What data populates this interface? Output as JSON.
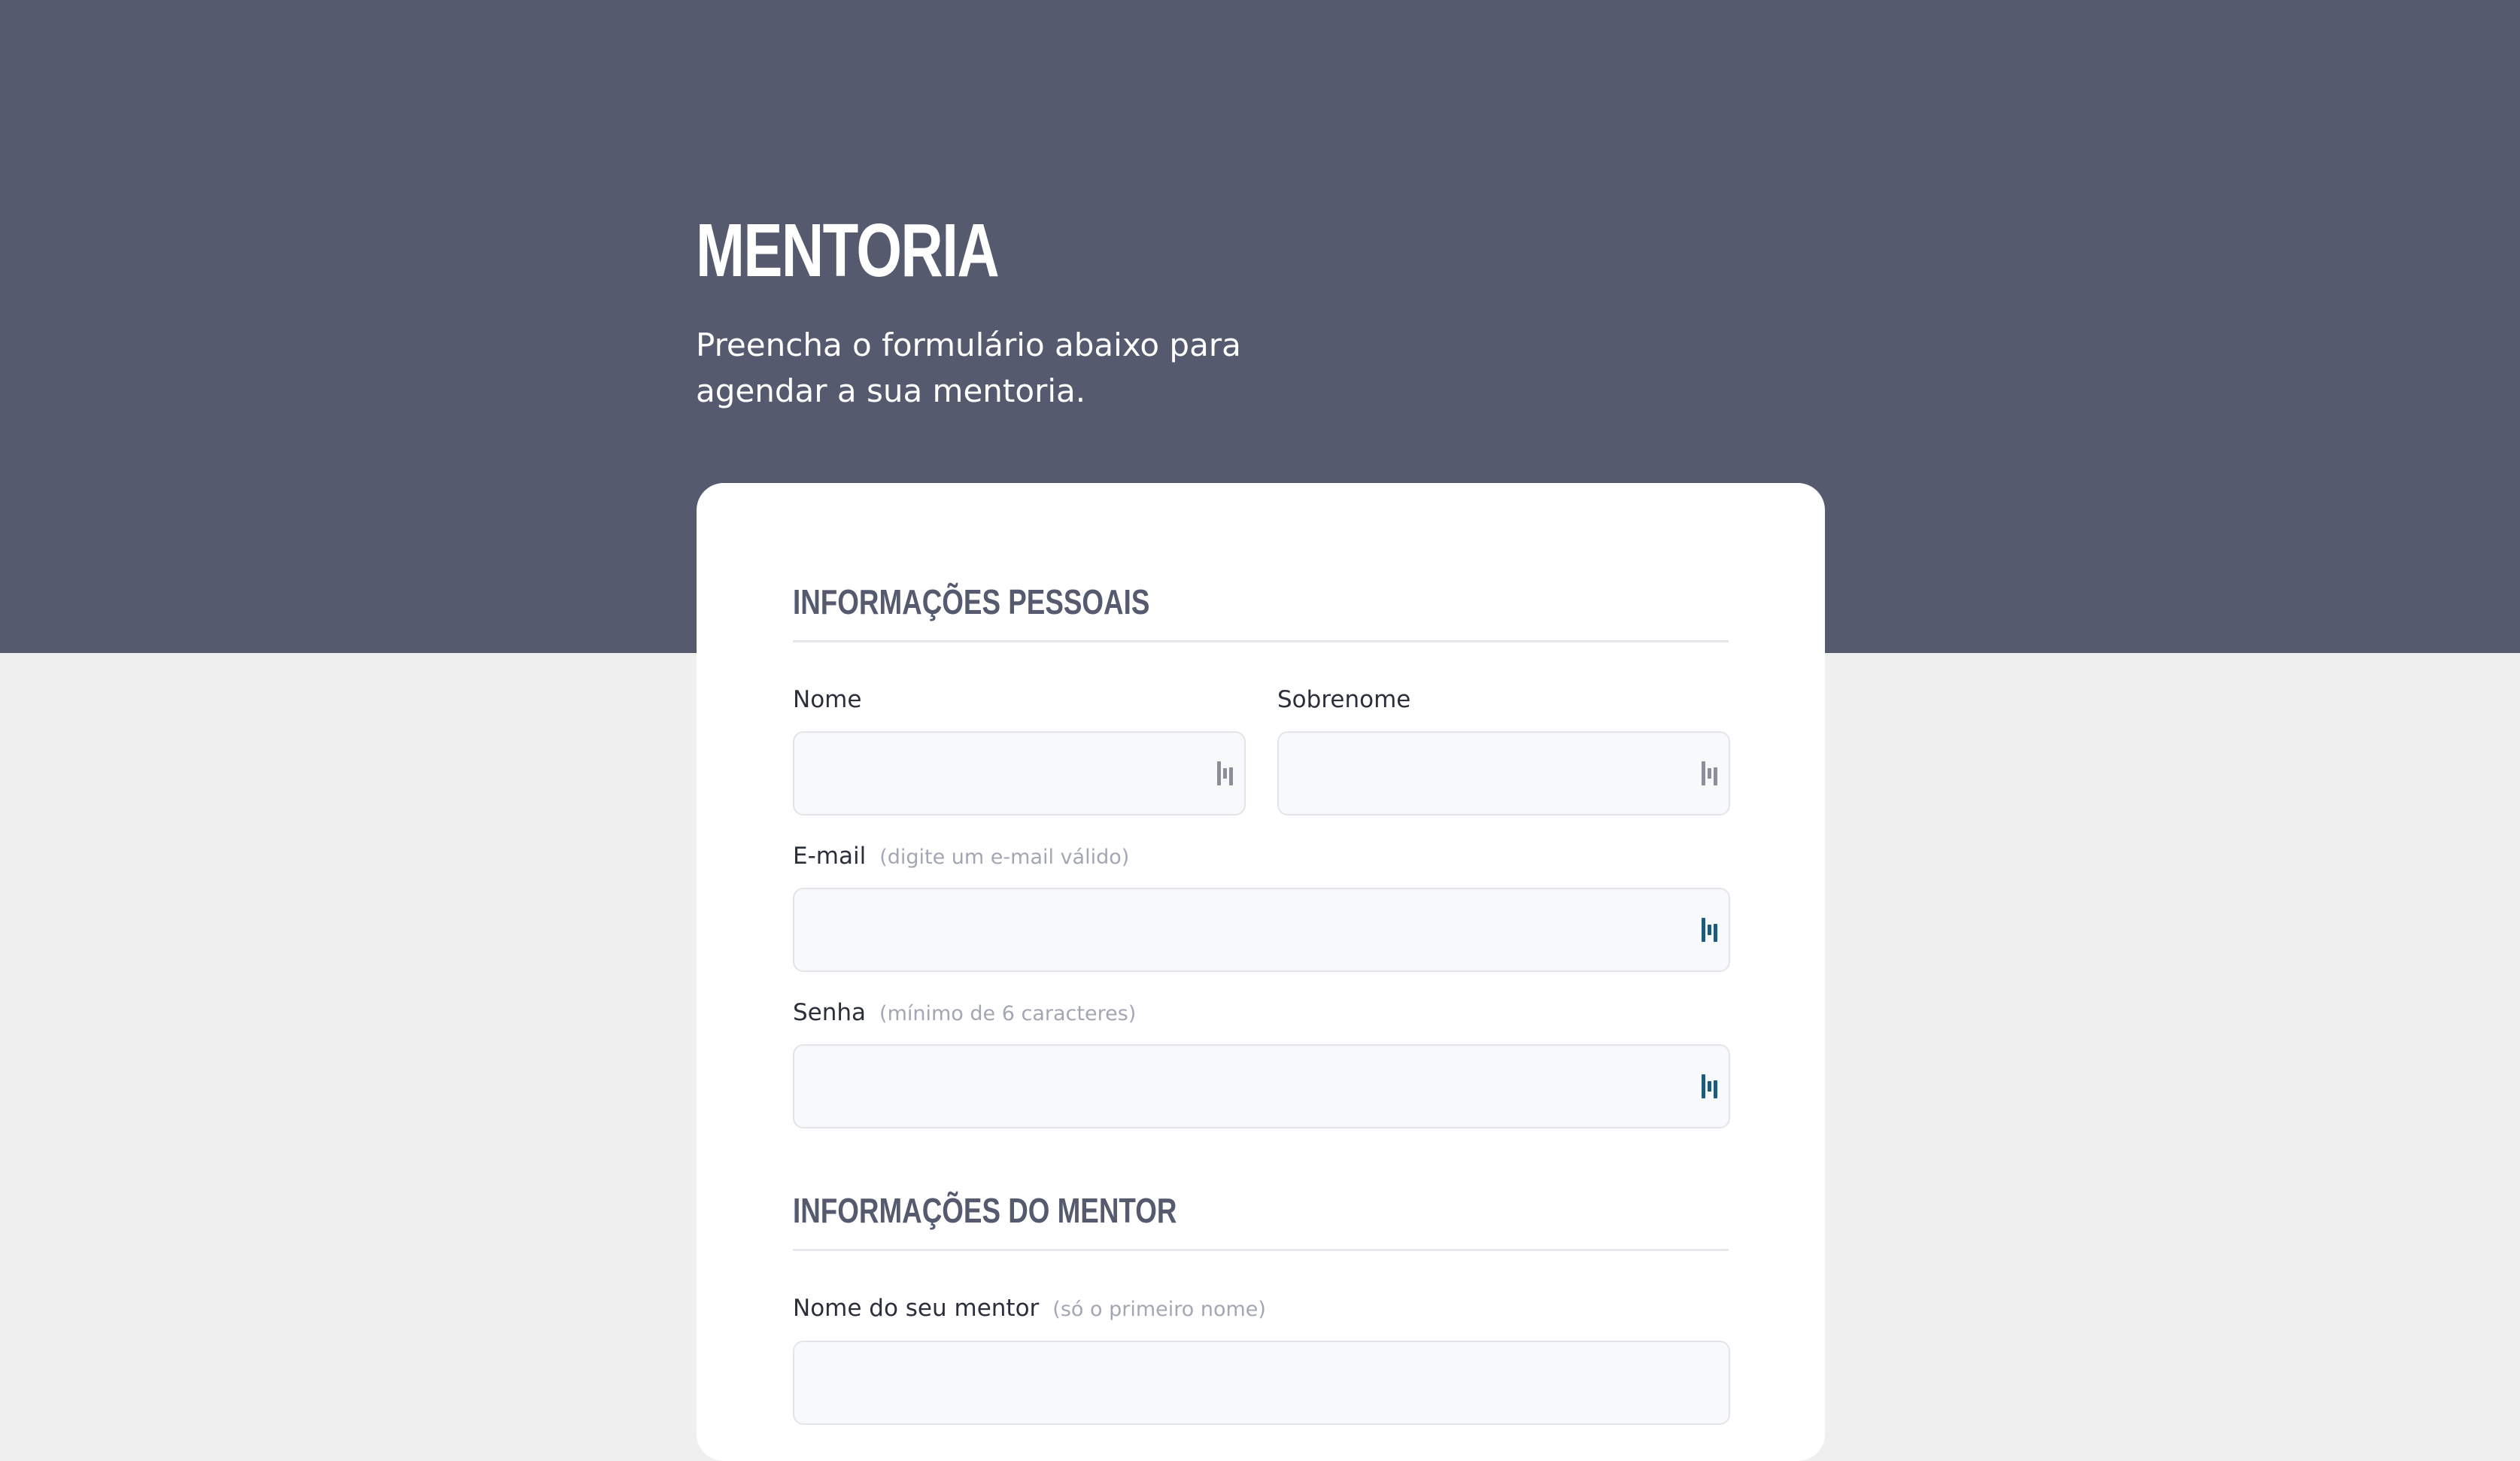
{
  "header": {
    "title": "MENTORIA",
    "subtitle": "Preencha o formulário abaixo para agendar a sua mentoria."
  },
  "form": {
    "personal_section": {
      "heading": "INFORMAÇÕES PESSOAIS",
      "first_name": {
        "label": "Nome",
        "value": "",
        "placeholder": ""
      },
      "last_name": {
        "label": "Sobrenome",
        "value": "",
        "placeholder": ""
      },
      "email": {
        "label": "E-mail",
        "hint": "(digite um e-mail válido)",
        "value": "",
        "placeholder": ""
      },
      "password": {
        "label": "Senha",
        "hint": "(mínimo de 6 caracteres)",
        "value": "",
        "placeholder": ""
      }
    },
    "mentor_section": {
      "heading": "INFORMAÇÕES DO MENTOR",
      "mentor_name": {
        "label": "Nome do seu mentor",
        "hint": "(só o primeiro nome)",
        "value": "",
        "placeholder": ""
      }
    }
  },
  "icons": {
    "autofill_icon": "password-manager-icon"
  },
  "colors": {
    "header_background": "#555a6f",
    "page_background": "#efefef",
    "heading_color": "#555a6f",
    "hint_color": "#a3a7b3",
    "icon_gray": "#8c8f99",
    "icon_teal": "#1f5a7a"
  }
}
